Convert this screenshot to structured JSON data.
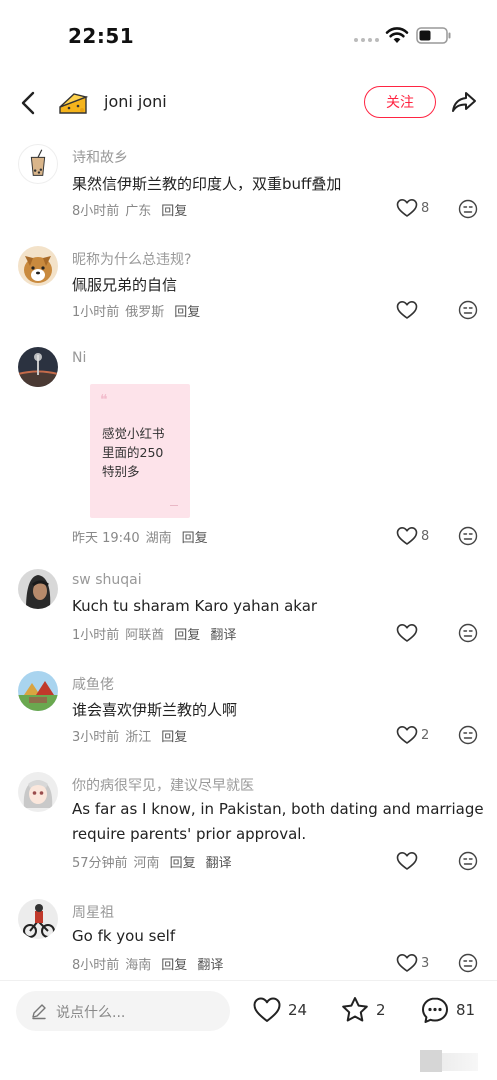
{
  "status": {
    "time": "22:51"
  },
  "header": {
    "name": "joni joni",
    "follow_label": "关注"
  },
  "comments": [
    {
      "user": "诗和故乡",
      "text": "果然信伊斯兰教的印度人，双重buff叠加",
      "text2": "",
      "time": "8小时前",
      "location": "广东",
      "reply": "回复",
      "translate": "",
      "likes": "8"
    },
    {
      "user": "昵称为什么总违规?",
      "text": "佩服兄弟的自信",
      "text2": "",
      "time": "1小时前",
      "location": "俄罗斯",
      "reply": "回复",
      "translate": "",
      "likes": ""
    },
    {
      "user": "Ni",
      "text": "",
      "text2": "",
      "time": "昨天 19:40",
      "location": "湖南",
      "reply": "回复",
      "translate": "",
      "likes": "8"
    },
    {
      "user": "sw shuqai",
      "text": "Kuch tu sharam Karo yahan akar",
      "text2": "",
      "time": "1小时前",
      "location": "阿联酋",
      "reply": "回复",
      "translate": "翻译",
      "likes": ""
    },
    {
      "user": "咸鱼佬",
      "text": "谁会喜欢伊斯兰教的人啊",
      "text2": "",
      "time": "3小时前",
      "location": "浙江",
      "reply": "回复",
      "translate": "",
      "likes": "2"
    },
    {
      "user": "你的病很罕见，建议尽早就医",
      "text": "As far as I know, in Pakistan, both dating and marriage",
      "text2": "require parents' prior approval.",
      "time": "57分钟前",
      "location": "河南",
      "reply": "回复",
      "translate": "翻译",
      "likes": ""
    },
    {
      "user": "周星祖",
      "text": "Go fk you self",
      "text2": "",
      "time": "8小时前",
      "location": "海南",
      "reply": "回复",
      "translate": "翻译",
      "likes": "3"
    }
  ],
  "image_card": {
    "text": "感觉小红书\n里面的250\n特别多"
  },
  "bottom": {
    "placeholder": "说点什么...",
    "likes": "24",
    "stars": "2",
    "comments": "81"
  },
  "colors": {
    "accent": "#ff2442"
  }
}
